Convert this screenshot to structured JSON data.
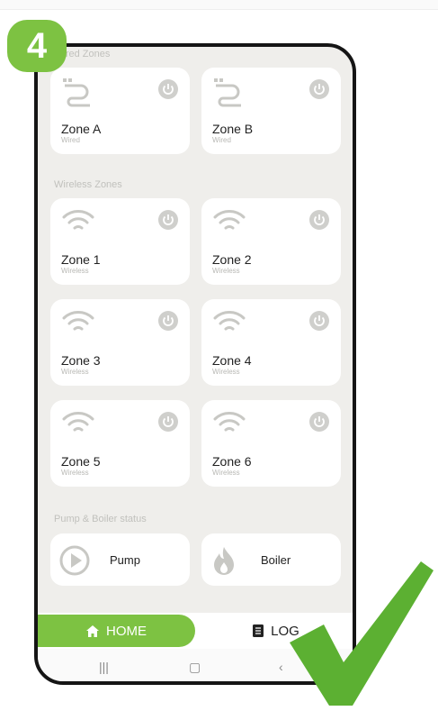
{
  "step": "4",
  "sections": {
    "wired": "Wired Zones",
    "wireless": "Wireless Zones",
    "status": "Pump & Boiler status"
  },
  "zones": [
    {
      "name": "Zone A",
      "type": "Wired",
      "icon": "wired-icon"
    },
    {
      "name": "Zone B",
      "type": "Wired",
      "icon": "wired-icon"
    },
    {
      "name": "Zone 1",
      "type": "Wireless",
      "icon": "wifi-icon"
    },
    {
      "name": "Zone 2",
      "type": "Wireless",
      "icon": "wifi-icon"
    },
    {
      "name": "Zone 3",
      "type": "Wireless",
      "icon": "wifi-icon"
    },
    {
      "name": "Zone 4",
      "type": "Wireless",
      "icon": "wifi-icon"
    },
    {
      "name": "Zone 5",
      "type": "Wireless",
      "icon": "wifi-icon"
    },
    {
      "name": "Zone 6",
      "type": "Wireless",
      "icon": "wifi-icon"
    }
  ],
  "status": {
    "pump": "Pump",
    "boiler": "Boiler"
  },
  "nav": {
    "home": "HOME",
    "log": "LOG"
  },
  "colors": {
    "accent": "#7dc242",
    "background": "#efeeeb",
    "card": "#ffffff",
    "icon": "#c8c8c4"
  }
}
